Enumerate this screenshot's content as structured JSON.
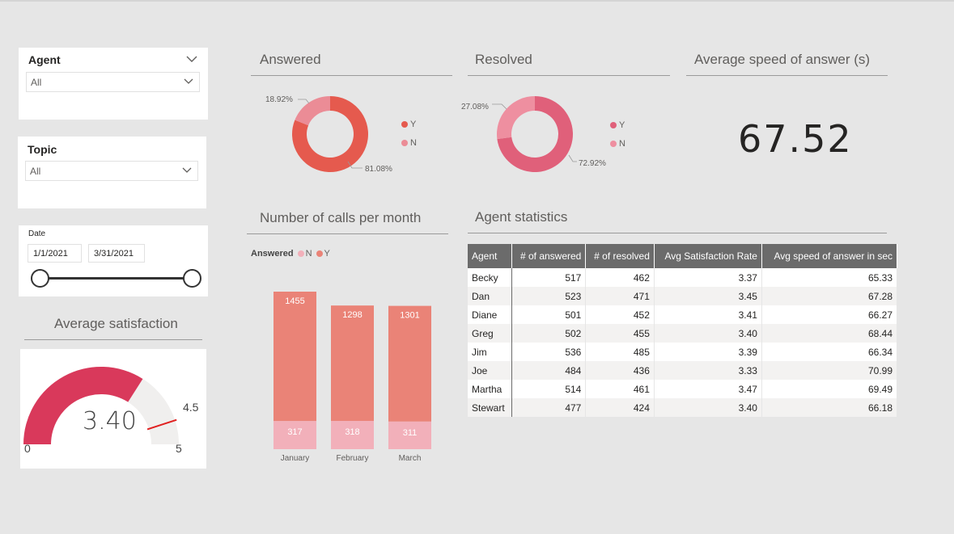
{
  "colors": {
    "y_donut": "#e55a4e",
    "n_donut": "#eb8c96",
    "resolved_y": "#e0607a",
    "resolved_n": "#ee8fa0",
    "bar_y": "#ea8377",
    "bar_n": "#f2b0ba",
    "gauge_fill": "#d9395b",
    "gauge_track": "#f0efee",
    "gauge_target": "#e02020"
  },
  "slicers": {
    "agent": {
      "title": "Agent",
      "value": "All"
    },
    "topic": {
      "title": "Topic",
      "value": "All"
    },
    "date": {
      "title": "Date",
      "start": "1/1/2021",
      "end": "3/31/2021"
    }
  },
  "answered": {
    "title": "Answered",
    "legend": [
      "Y",
      "N"
    ],
    "y_pct": 81.08,
    "n_pct": 18.92,
    "y_label": "81.08%",
    "n_label": "18.92%"
  },
  "resolved": {
    "title": "Resolved",
    "legend": [
      "Y",
      "N"
    ],
    "y_pct": 72.92,
    "n_pct": 27.08,
    "y_label": "72.92%",
    "n_label": "27.08%"
  },
  "speed": {
    "title": "Average speed of answer (s)",
    "value": "67.52"
  },
  "satisfaction": {
    "title": "Average satisfaction",
    "value": "3.40",
    "min": "0",
    "max": "5",
    "target": "4.5",
    "value_num": 3.4,
    "target_num": 4.5,
    "max_num": 5
  },
  "calls": {
    "title": "Number of calls per month",
    "legend_title": "Answered",
    "legend_n": "N",
    "legend_y": "Y"
  },
  "chart_data": {
    "type": "bar",
    "stacked": true,
    "categories": [
      "January",
      "February",
      "March"
    ],
    "series": [
      {
        "name": "Y",
        "values": [
          1455,
          1298,
          1301
        ]
      },
      {
        "name": "N",
        "values": [
          317,
          318,
          311
        ]
      }
    ],
    "legend_title": "Answered",
    "legend_position": "top-left"
  },
  "agent_stats": {
    "title": "Agent statistics",
    "headers": [
      "Agent",
      "# of answered",
      "# of resolved",
      "Avg Satisfaction Rate",
      "Avg speed of answer in sec"
    ],
    "rows": [
      [
        "Becky",
        "517",
        "462",
        "3.37",
        "65.33"
      ],
      [
        "Dan",
        "523",
        "471",
        "3.45",
        "67.28"
      ],
      [
        "Diane",
        "501",
        "452",
        "3.41",
        "66.27"
      ],
      [
        "Greg",
        "502",
        "455",
        "3.40",
        "68.44"
      ],
      [
        "Jim",
        "536",
        "485",
        "3.39",
        "66.34"
      ],
      [
        "Joe",
        "484",
        "436",
        "3.33",
        "70.99"
      ],
      [
        "Martha",
        "514",
        "461",
        "3.47",
        "69.49"
      ],
      [
        "Stewart",
        "477",
        "424",
        "3.40",
        "66.18"
      ]
    ]
  }
}
